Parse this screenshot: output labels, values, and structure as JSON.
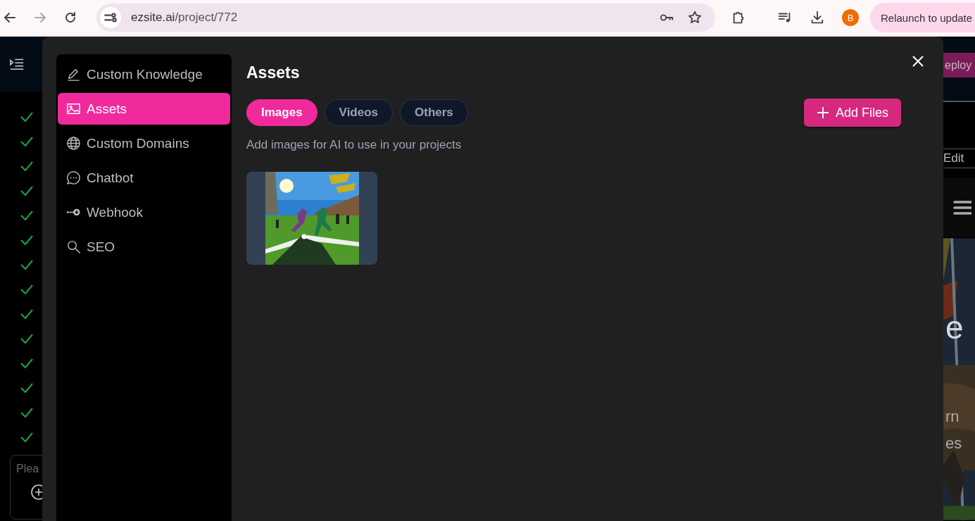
{
  "browser": {
    "url_host": "ezsite.ai",
    "url_path": "/project/772",
    "profile_initial": "B",
    "relaunch_button": "Relaunch to update"
  },
  "app": {
    "checklist": [
      {
        "done": true
      },
      {
        "done": true
      },
      {
        "done": true
      },
      {
        "done": true
      },
      {
        "done": true
      },
      {
        "done": true
      },
      {
        "done": true
      },
      {
        "done": true
      },
      {
        "done": true
      },
      {
        "done": true
      },
      {
        "done": true
      },
      {
        "done": true
      },
      {
        "done": true
      },
      {
        "done": true
      }
    ],
    "prompt_placeholder": "Plea",
    "deploy_button": "eploy",
    "edit_tab": "Edit",
    "hero_texts": [
      "e",
      "rn",
      "es"
    ]
  },
  "modal": {
    "sidebar": [
      {
        "label": "Custom Knowledge",
        "selected": false
      },
      {
        "label": "Assets",
        "selected": true
      },
      {
        "label": "Custom Domains",
        "selected": false
      },
      {
        "label": "Chatbot",
        "selected": false
      },
      {
        "label": "Webhook",
        "selected": false
      },
      {
        "label": "SEO",
        "selected": false
      }
    ],
    "title": "Assets",
    "filters": [
      {
        "label": "Images",
        "selected": true
      },
      {
        "label": "Videos",
        "selected": false
      },
      {
        "label": "Others",
        "selected": false
      }
    ],
    "add_button": "Add Files",
    "description": "Add images for AI to use in your projects"
  }
}
